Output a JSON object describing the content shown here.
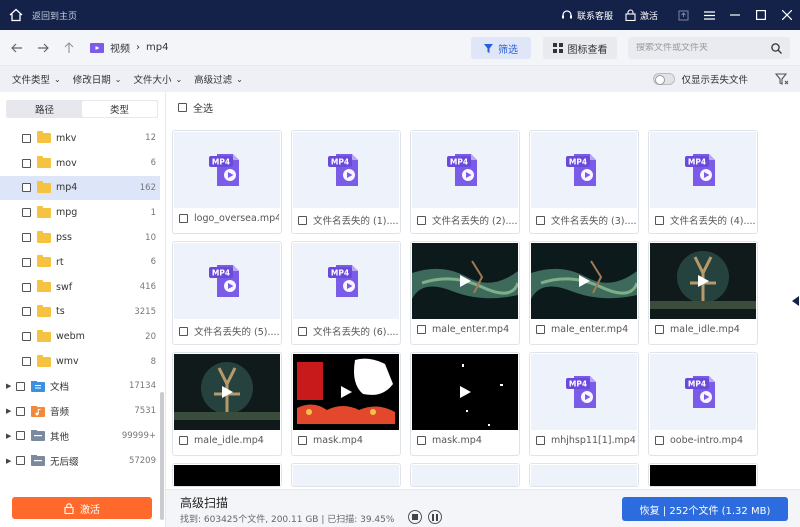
{
  "titlebar": {
    "back_home": "返回到主页",
    "contact": "联系客服",
    "activate": "激活"
  },
  "nav": {
    "crumb_root": "视频",
    "crumb_current": "mp4",
    "filter_btn": "筛选",
    "icon_view_btn": "图标查看",
    "search_placeholder": "搜索文件或文件夹"
  },
  "filters": {
    "file_type": "文件类型",
    "modified_date": "修改日期",
    "file_size": "文件大小",
    "advanced": "高级过滤",
    "only_lost": "仅显示丢失文件"
  },
  "sidebar": {
    "seg_path": "路径",
    "seg_type": "类型",
    "items": [
      {
        "label": "mkv",
        "count": "12"
      },
      {
        "label": "mov",
        "count": "6"
      },
      {
        "label": "mp4",
        "count": "162"
      },
      {
        "label": "mpg",
        "count": "1"
      },
      {
        "label": "pss",
        "count": "10"
      },
      {
        "label": "rt",
        "count": "6"
      },
      {
        "label": "swf",
        "count": "416"
      },
      {
        "label": "ts",
        "count": "3215"
      },
      {
        "label": "webm",
        "count": "20"
      },
      {
        "label": "wmv",
        "count": "8"
      }
    ],
    "groups": [
      {
        "label": "文档",
        "count": "17134",
        "color": "#3d8fe0"
      },
      {
        "label": "音频",
        "count": "7531",
        "color": "#f08a3c"
      },
      {
        "label": "其他",
        "count": "99999+",
        "color": "#7c8aa0"
      },
      {
        "label": "无后缀",
        "count": "57209",
        "color": "#7c8aa0"
      }
    ],
    "activate_btn": "激活"
  },
  "main": {
    "select_all": "全选",
    "files": [
      {
        "name": "logo_oversea.mp4",
        "kind": "file"
      },
      {
        "name": "文件名丢失的 (1)....",
        "kind": "file"
      },
      {
        "name": "文件名丢失的 (2)....",
        "kind": "file"
      },
      {
        "name": "文件名丢失的 (3)....",
        "kind": "file"
      },
      {
        "name": "文件名丢失的 (4)....",
        "kind": "file"
      },
      {
        "name": "文件名丢失的 (5)....",
        "kind": "file"
      },
      {
        "name": "文件名丢失的 (6)....",
        "kind": "file"
      },
      {
        "name": "male_enter.mp4",
        "kind": "scene"
      },
      {
        "name": "male_enter.mp4",
        "kind": "scene"
      },
      {
        "name": "male_idle.mp4",
        "kind": "scene2"
      },
      {
        "name": "male_idle.mp4",
        "kind": "scene2"
      },
      {
        "name": "mask.mp4",
        "kind": "mask"
      },
      {
        "name": "mask.mp4",
        "kind": "dark"
      },
      {
        "name": "mhjhsp11[1].mp4",
        "kind": "file"
      },
      {
        "name": "oobe-intro.mp4",
        "kind": "file"
      }
    ]
  },
  "bottom": {
    "title": "高级扫描",
    "info": "找到: 603425个文件, 200.11 GB | 已扫描: 39.45%",
    "recover_btn": "恢复 | 252个文件 (1.32 MB)"
  },
  "colors": {
    "titlebar": "#14224a",
    "accent": "#2d6cdf",
    "activate": "#ff6a2c",
    "folder": "#f5c242",
    "mp4_icon": "#7b5ce8"
  }
}
